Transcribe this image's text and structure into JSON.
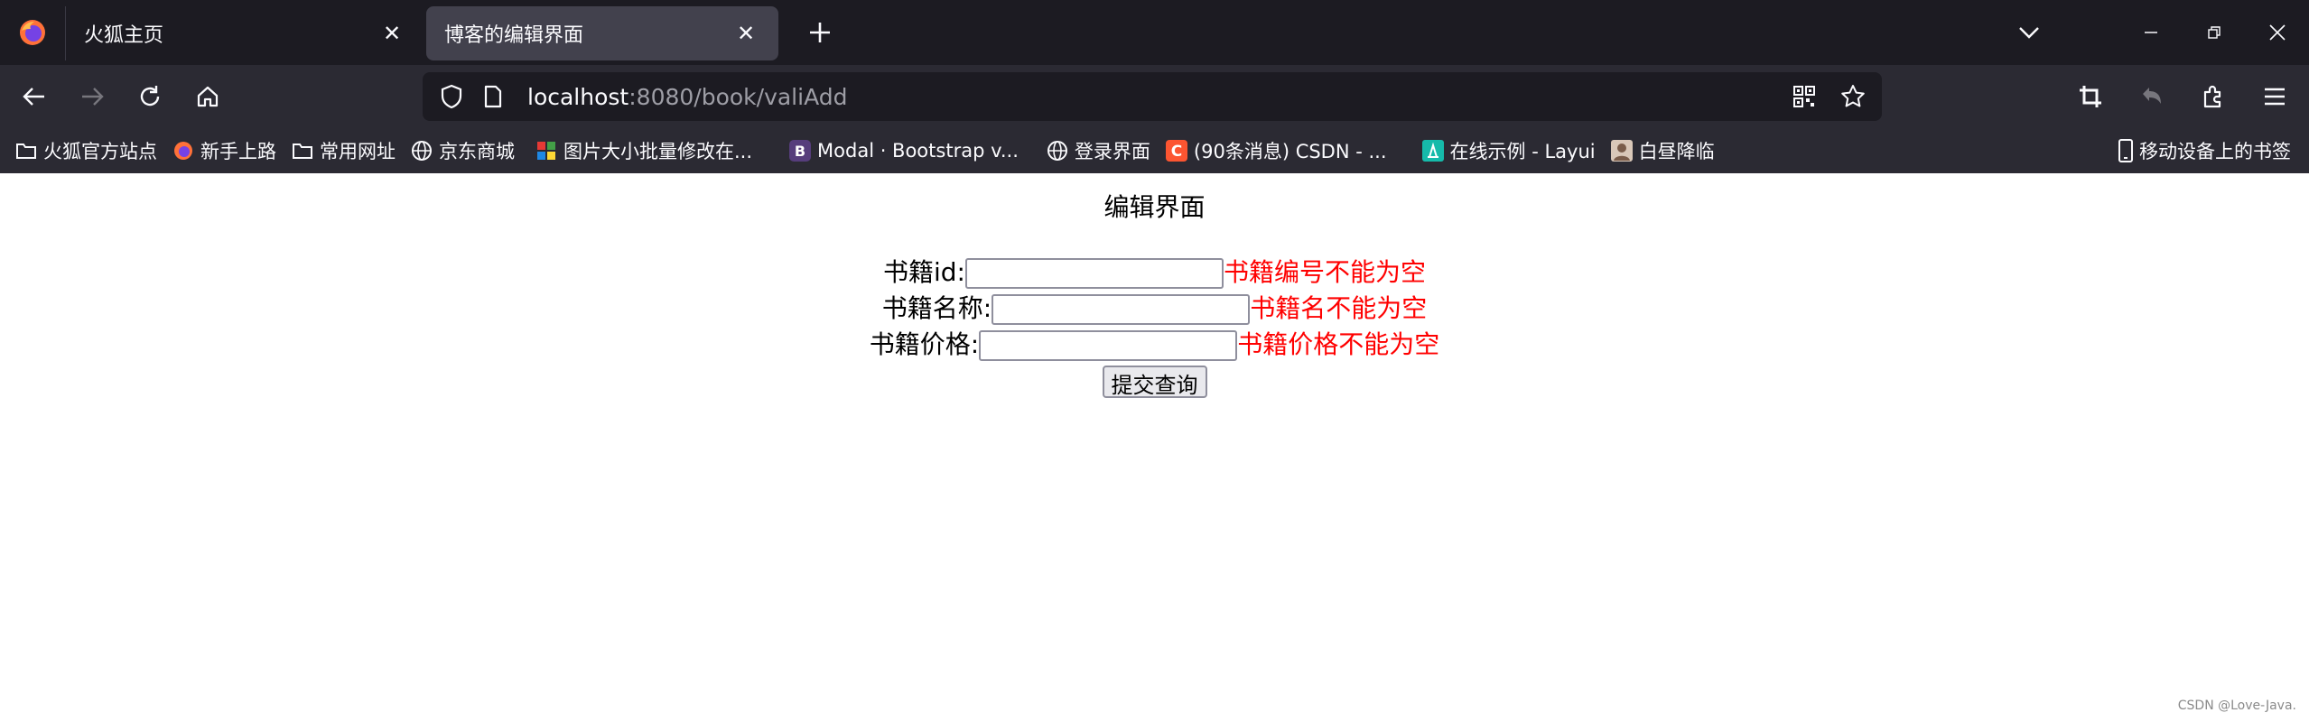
{
  "tabs": [
    {
      "title": "火狐主页",
      "active": false
    },
    {
      "title": "博客的编辑界面",
      "active": true
    }
  ],
  "url": {
    "host": "localhost",
    "path": ":8080/book/valiAdd"
  },
  "bookmarks": [
    {
      "label": "火狐官方站点",
      "icon": "folder-icon"
    },
    {
      "label": "新手上路",
      "icon": "firefox-icon"
    },
    {
      "label": "常用网址",
      "icon": "folder-icon"
    },
    {
      "label": "京东商城",
      "icon": "globe-icon"
    },
    {
      "label": "图片大小批量修改在...",
      "icon": "colorful-squares-icon"
    },
    {
      "label": "Modal · Bootstrap v...",
      "icon": "bootstrap-icon"
    },
    {
      "label": "登录界面",
      "icon": "globe-icon"
    },
    {
      "label": "(90条消息) CSDN - ...",
      "icon": "csdn-icon"
    },
    {
      "label": "在线示例 - Layui",
      "icon": "layui-icon"
    },
    {
      "label": "白昼降临",
      "icon": "avatar-icon"
    }
  ],
  "mobile_bookmarks": "移动设备上的书签",
  "page": {
    "heading": "编辑界面",
    "fields": [
      {
        "label": "书籍id:",
        "value": "",
        "error": "书籍编号不能为空"
      },
      {
        "label": "书籍名称:",
        "value": "",
        "error": "书籍名不能为空"
      },
      {
        "label": "书籍价格:",
        "value": "",
        "error": "书籍价格不能为空"
      }
    ],
    "submit_label": "提交查询"
  },
  "watermark": "CSDN @Love-Java.",
  "colors": {
    "tab_bg": "#1c1b22",
    "toolbar_bg": "#2b2a33",
    "active_tab": "#42414d",
    "error": "#ff0000"
  }
}
